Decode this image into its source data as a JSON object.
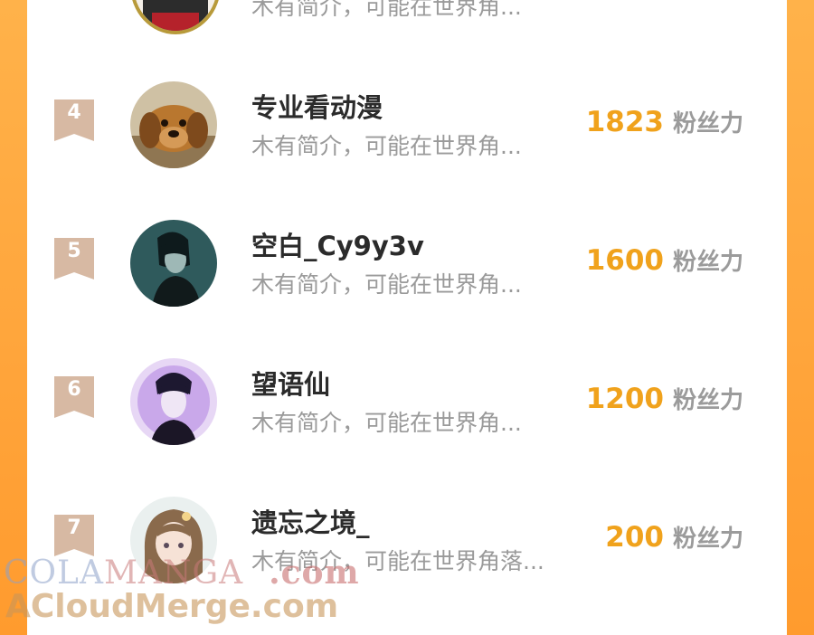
{
  "top_partial": {
    "intro": "木有简介，可能在世界角..."
  },
  "score_unit": "粉丝力",
  "rows": [
    {
      "rank": "4",
      "name": "专业看动漫",
      "intro": "木有简介，可能在世界角...",
      "score": "1823",
      "avatar": "dog-avatar"
    },
    {
      "rank": "5",
      "name": "空白_Cy9y3v",
      "intro": "木有简介，可能在世界角...",
      "score": "1600",
      "avatar": "dark-anime-boy-avatar"
    },
    {
      "rank": "6",
      "name": "望语仙",
      "intro": "木有简介，可能在世界角...",
      "score": "1200",
      "avatar": "purple-anime-boy-avatar"
    },
    {
      "rank": "7",
      "name": "遗忘之境_",
      "intro": "木有简介，可能在世界角落...",
      "score": "200",
      "avatar": "anime-girl-avatar"
    }
  ],
  "watermark": {
    "line1_a": "COLA",
    "line1_b": "MANGA",
    "line1_c": ".com",
    "line2": "ACloudMerge.com"
  },
  "colors": {
    "background": "#ffa43a",
    "score": "#f0a21c",
    "badge": "#d7b9a3"
  }
}
